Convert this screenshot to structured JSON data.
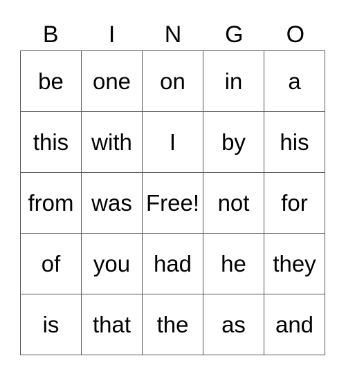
{
  "header": [
    "B",
    "I",
    "N",
    "G",
    "O"
  ],
  "cells": [
    [
      "be",
      "one",
      "on",
      "in",
      "a"
    ],
    [
      "this",
      "with",
      "I",
      "by",
      "his"
    ],
    [
      "from",
      "was",
      "Free!",
      "not",
      "for"
    ],
    [
      "of",
      "you",
      "had",
      "he",
      "they"
    ],
    [
      "is",
      "that",
      "the",
      "as",
      "and"
    ]
  ]
}
